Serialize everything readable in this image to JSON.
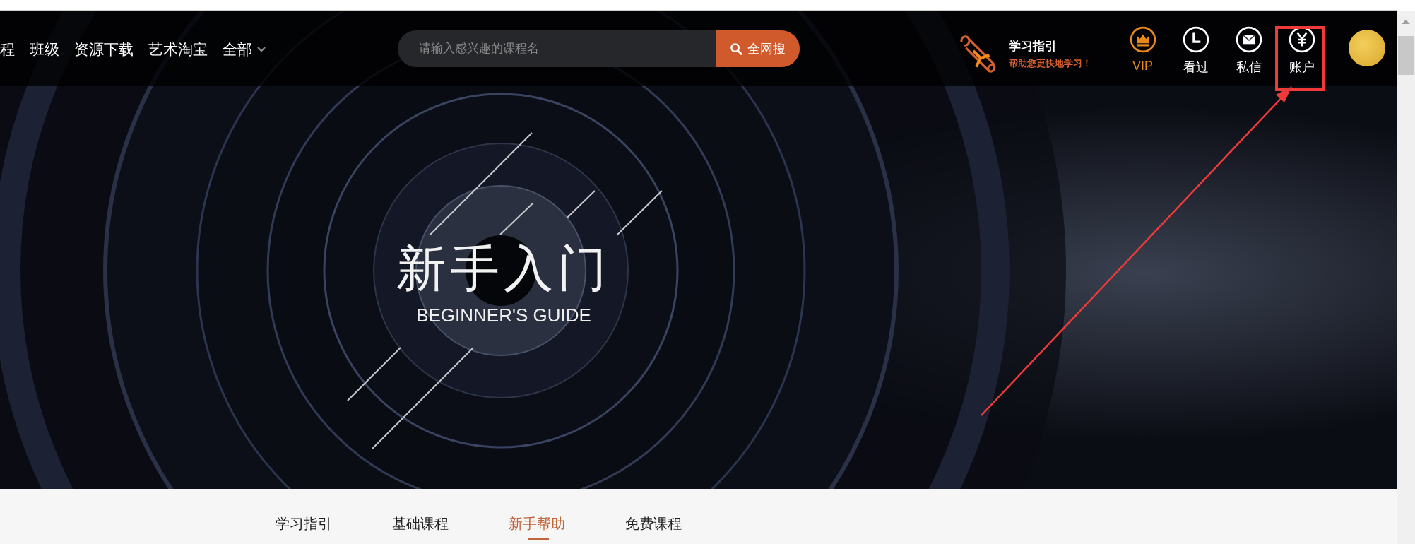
{
  "nav": {
    "items": [
      {
        "label": "程",
        "dropdown": false
      },
      {
        "label": "班级",
        "dropdown": false
      },
      {
        "label": "资源下载",
        "dropdown": false
      },
      {
        "label": "艺术淘宝",
        "dropdown": false
      },
      {
        "label": "全部",
        "dropdown": true
      }
    ]
  },
  "search": {
    "placeholder": "请输入感兴趣的课程名",
    "button": "全网搜"
  },
  "guide": {
    "title": "学习指引",
    "subtitle": "帮助您更快地学习！"
  },
  "user_menu": [
    {
      "label": "VIP",
      "kind": "vip",
      "annotated": false
    },
    {
      "label": "看过",
      "kind": "history",
      "annotated": false
    },
    {
      "label": "私信",
      "kind": "message",
      "annotated": false
    },
    {
      "label": "账户",
      "kind": "account",
      "annotated": true
    }
  ],
  "hero": {
    "title": "新手入门",
    "subtitle": "BEGINNER'S GUIDE"
  },
  "tabs": [
    {
      "label": "学习指引",
      "selected": false
    },
    {
      "label": "基础课程",
      "selected": false
    },
    {
      "label": "新手帮助",
      "selected": true
    },
    {
      "label": "免费课程",
      "selected": false
    }
  ]
}
